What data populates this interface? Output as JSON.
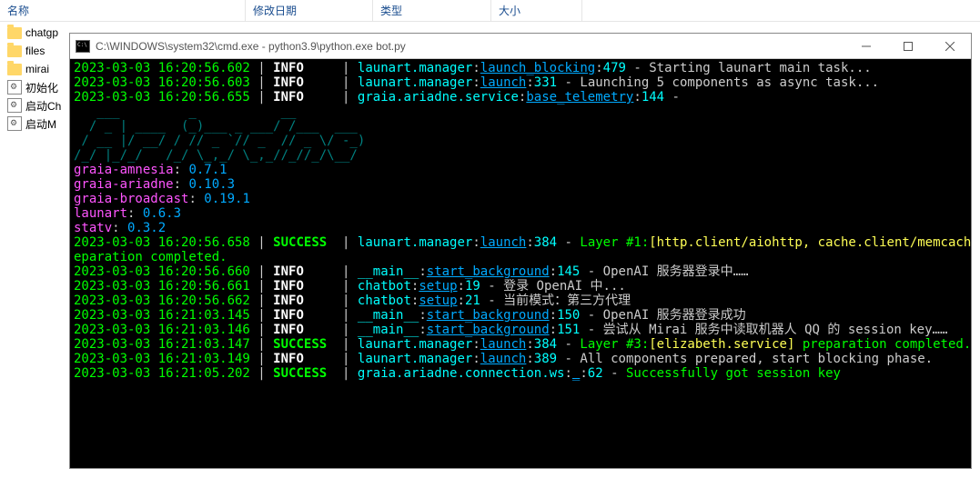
{
  "explorer": {
    "columns": {
      "name": "名称",
      "date": "修改日期",
      "type": "类型",
      "size": "大小"
    },
    "items": [
      {
        "icon": "folder",
        "label": "chatgp"
      },
      {
        "icon": "folder",
        "label": "files"
      },
      {
        "icon": "folder",
        "label": "mirai"
      },
      {
        "icon": "bat",
        "label": "初始化"
      },
      {
        "icon": "bat",
        "label": "启动Ch"
      },
      {
        "icon": "bat",
        "label": "启动M"
      }
    ]
  },
  "cmd": {
    "title": "C:\\WINDOWS\\system32\\cmd.exe - python3.9\\python.exe  bot.py",
    "ascii": [
      "   ___         _           __",
      "  / _ | ____  (_)___ _ ___/ /___  ___",
      " / __ |/ __/ / // _ `// _  // _ \\/ -_)",
      "/_/ |_/_/   /_/ \\_,_/ \\_,_//_//_/\\__/"
    ],
    "packages": [
      {
        "name": "graia-amnesia",
        "ver": "0.7.1"
      },
      {
        "name": "graia-ariadne",
        "ver": "0.10.3"
      },
      {
        "name": "graia-broadcast",
        "ver": "0.19.1"
      },
      {
        "name": "launart",
        "ver": "0.6.3"
      },
      {
        "name": "statv",
        "ver": "0.3.2"
      }
    ],
    "lines": [
      {
        "ts": "2023-03-03 16:20:56.602",
        "level": "INFO",
        "mod": "launart.manager",
        "func": "launch_blocking",
        "ln": "479",
        "msg": "Starting launart main task..."
      },
      {
        "ts": "2023-03-03 16:20:56.603",
        "level": "INFO",
        "mod": "launart.manager",
        "func": "launch",
        "ln": "331",
        "msg": "Launching 5 components as async task..."
      },
      {
        "ts": "2023-03-03 16:20:56.655",
        "level": "INFO",
        "mod": "graia.ariadne.service",
        "func": "base_telemetry",
        "ln": "144",
        "msg": ""
      },
      {
        "ts": "2023-03-03 16:20:56.658",
        "level": "SUCCESS",
        "mod": "launart.manager",
        "func": "launch",
        "ln": "384",
        "special": "layer1"
      },
      {
        "ts": "2023-03-03 16:20:56.660",
        "level": "INFO",
        "mod": "__main__",
        "func": "start_background",
        "ln": "145",
        "msg": "OpenAI 服务器登录中……"
      },
      {
        "ts": "2023-03-03 16:20:56.661",
        "level": "INFO",
        "mod": "chatbot",
        "func": "setup",
        "ln": "19",
        "msg": "登录 OpenAI 中..."
      },
      {
        "ts": "2023-03-03 16:20:56.662",
        "level": "INFO",
        "mod": "chatbot",
        "func": "setup",
        "ln": "21",
        "msg": "当前模式：第三方代理"
      },
      {
        "ts": "2023-03-03 16:21:03.145",
        "level": "INFO",
        "mod": "__main__",
        "func": "start_background",
        "ln": "150",
        "msg": "OpenAI 服务器登录成功"
      },
      {
        "ts": "2023-03-03 16:21:03.146",
        "level": "INFO",
        "mod": "__main__",
        "func": "start_background",
        "ln": "151",
        "msg": "尝试从 Mirai 服务中读取机器人 QQ 的 session key……"
      },
      {
        "ts": "2023-03-03 16:21:03.147",
        "level": "SUCCESS",
        "mod": "launart.manager",
        "func": "launch",
        "ln": "384",
        "special": "layer3"
      },
      {
        "ts": "2023-03-03 16:21:03.149",
        "level": "INFO",
        "mod": "launart.manager",
        "func": "launch",
        "ln": "389",
        "msg": "All components prepared, start blocking phase."
      },
      {
        "ts": "2023-03-03 16:21:05.202",
        "level": "SUCCESS",
        "mod": "graia.ariadne.connection.ws",
        "func": "_",
        "ln": "62",
        "special": "session"
      }
    ],
    "specials": {
      "layer1_pre": "Layer #1:",
      "layer1_yellow": "[http.client/aiohttp, cache.client/memcache]",
      "layer1_post_a": " pr",
      "layer1_post_b": "eparation completed.",
      "layer3_pre": "Layer #3:",
      "layer3_yellow": "[elizabeth.service]",
      "layer3_post": " preparation completed.",
      "session": "Successfully got session key"
    }
  }
}
